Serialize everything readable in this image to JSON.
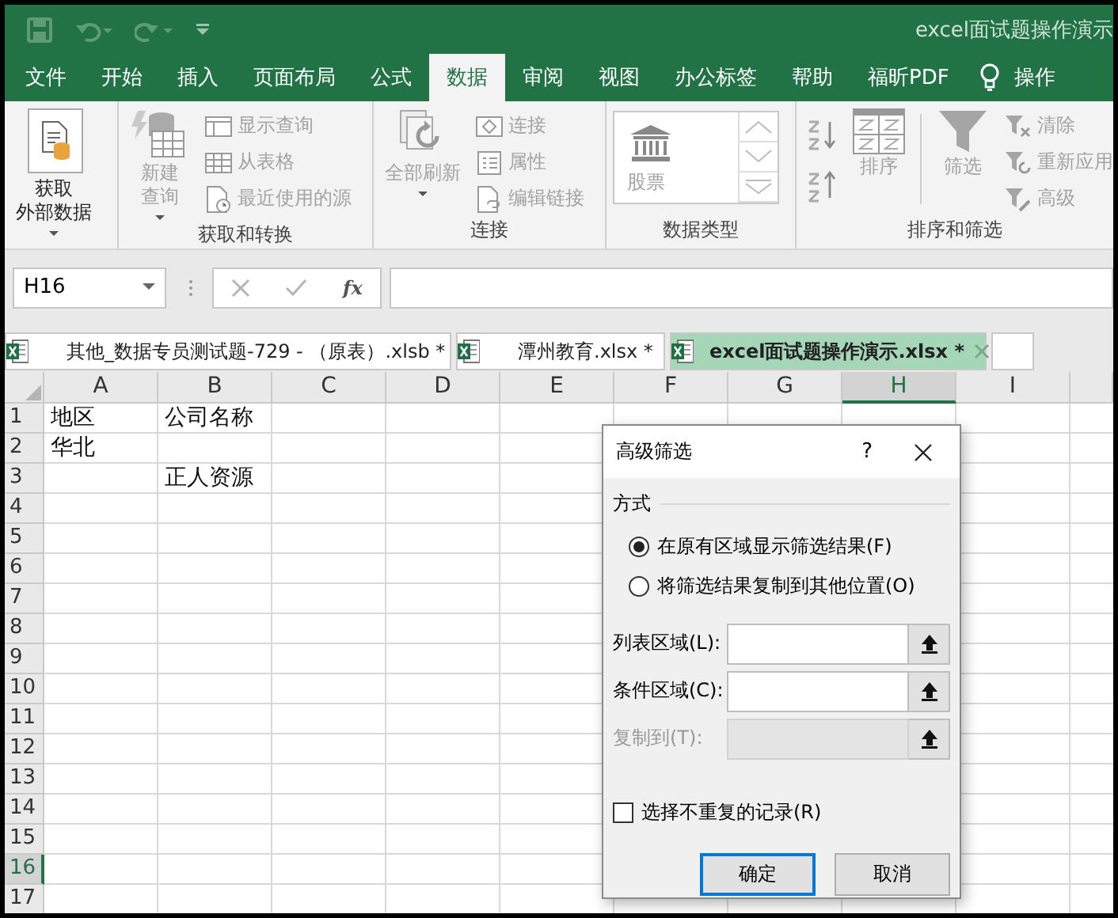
{
  "title_bar": {
    "title": "excel面试题操作演示"
  },
  "ribbon_tabs": [
    {
      "label": "文件",
      "selected": false
    },
    {
      "label": "开始",
      "selected": false
    },
    {
      "label": "插入",
      "selected": false
    },
    {
      "label": "页面布局",
      "selected": false
    },
    {
      "label": "公式",
      "selected": false
    },
    {
      "label": "数据",
      "selected": true
    },
    {
      "label": "审阅",
      "selected": false
    },
    {
      "label": "视图",
      "selected": false
    },
    {
      "label": "办公标签",
      "selected": false
    },
    {
      "label": "帮助",
      "selected": false
    },
    {
      "label": "福昕PDF",
      "selected": false
    }
  ],
  "tell_me": {
    "label": "操作"
  },
  "ribbon_groups": [
    {
      "columns": [
        [
          {
            "kind": "large",
            "label_lines": [
              "获取",
              "外部数据"
            ],
            "disabled": false,
            "dropdown": true
          }
        ]
      ]
    },
    {
      "title": "获取和转换",
      "columns": [
        [
          {
            "kind": "large",
            "label_lines": [
              "新建",
              "查询"
            ],
            "disabled": true,
            "dropdown": true
          }
        ],
        [
          {
            "kind": "small",
            "label": "显示查询",
            "disabled": true
          },
          {
            "kind": "small",
            "label": "从表格",
            "disabled": true
          },
          {
            "kind": "small",
            "label": "最近使用的源",
            "disabled": true
          }
        ]
      ]
    },
    {
      "title": "连接",
      "columns": [
        [
          {
            "kind": "large",
            "label_lines": [
              "全部刷新"
            ],
            "disabled": true,
            "dropdown": true
          }
        ],
        [
          {
            "kind": "small",
            "label": "连接",
            "disabled": true
          },
          {
            "kind": "small",
            "label": "属性",
            "disabled": true
          },
          {
            "kind": "small",
            "label": "编辑链接",
            "disabled": true
          }
        ]
      ]
    },
    {
      "title": "数据类型",
      "columns": [
        [
          {
            "kind": "gallery",
            "label": "股票",
            "disabled": true
          }
        ]
      ]
    },
    {
      "title": "排序和筛选",
      "columns": [
        [
          {
            "kind": "icon",
            "disabled": true
          },
          {
            "kind": "icon",
            "disabled": true
          }
        ],
        [
          {
            "kind": "large",
            "label_lines": [
              "排序"
            ],
            "disabled": true
          }
        ],
        [
          {
            "kind": "large",
            "label_lines": [
              "筛选"
            ],
            "disabled": true
          }
        ],
        [
          {
            "kind": "small",
            "label": "清除",
            "disabled": true
          },
          {
            "kind": "small",
            "label": "重新应用",
            "disabled": true
          },
          {
            "kind": "small",
            "label": "高级",
            "disabled": true
          }
        ]
      ]
    }
  ],
  "formula_bar": {
    "name_box": "H16",
    "function_label": "fx"
  },
  "workbook_tabs": [
    {
      "label": "其他_数据专员测试题-729 -  （原表）.xlsb *",
      "selected": false
    },
    {
      "label": "潭州教育.xlsx *",
      "selected": false
    },
    {
      "label": "excel面试题操作演示.xlsx *",
      "selected": true
    }
  ],
  "sheet": {
    "columns": [
      {
        "label": "A",
        "selected": false
      },
      {
        "label": "B",
        "selected": false
      },
      {
        "label": "C",
        "selected": false
      },
      {
        "label": "D",
        "selected": false
      },
      {
        "label": "E",
        "selected": false
      },
      {
        "label": "F",
        "selected": false
      },
      {
        "label": "G",
        "selected": false
      },
      {
        "label": "H",
        "selected": true
      },
      {
        "label": "I",
        "selected": false
      }
    ],
    "rows": [
      {
        "number": "1",
        "selected": false,
        "cells": [
          "地区",
          "公司名称"
        ]
      },
      {
        "number": "2",
        "selected": false,
        "cells": [
          "华北"
        ]
      },
      {
        "number": "3",
        "selected": false,
        "cells": [
          null,
          "正人资源"
        ]
      },
      {
        "number": "4",
        "selected": false
      },
      {
        "number": "5",
        "selected": false
      },
      {
        "number": "6",
        "selected": false
      },
      {
        "number": "7",
        "selected": false
      },
      {
        "number": "8",
        "selected": false
      },
      {
        "number": "9",
        "selected": false
      },
      {
        "number": "10",
        "selected": false
      },
      {
        "number": "11",
        "selected": false
      },
      {
        "number": "12",
        "selected": false
      },
      {
        "number": "13",
        "selected": false
      },
      {
        "number": "14",
        "selected": false
      },
      {
        "number": "15",
        "selected": false
      },
      {
        "number": "16",
        "selected": true
      },
      {
        "number": "17",
        "selected": false
      }
    ]
  },
  "dialog": {
    "title": "高级筛选",
    "help": "?",
    "section": "方式",
    "options": [
      {
        "label": "在原有区域显示筛选结果(F)",
        "selected": true
      },
      {
        "label": "将筛选结果复制到其他位置(O)",
        "selected": false
      }
    ],
    "fields": [
      {
        "label": "列表区域(L):",
        "disabled": false
      },
      {
        "label": "条件区域(C):",
        "disabled": false
      },
      {
        "label": "复制到(T):",
        "disabled": true
      }
    ],
    "checkbox": {
      "label": "选择不重复的记录(R)",
      "checked": false
    },
    "buttons": [
      {
        "label": "确定",
        "default": true
      },
      {
        "label": "取消",
        "default": false
      }
    ]
  }
}
